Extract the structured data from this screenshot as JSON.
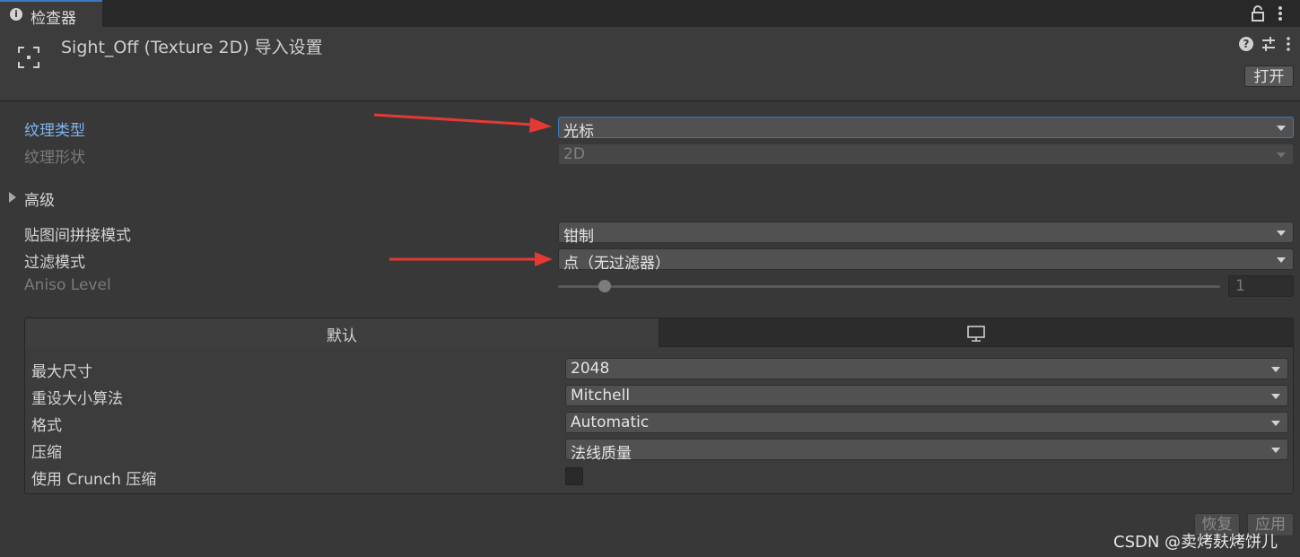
{
  "tab": {
    "label": "检查器"
  },
  "header": {
    "title": "Sight_Off (Texture 2D) 导入设置",
    "open_button": "打开"
  },
  "fields": {
    "texture_type": {
      "label": "纹理类型",
      "value": "光标"
    },
    "texture_shape": {
      "label": "纹理形状",
      "value": "2D"
    },
    "advanced": {
      "label": "高级"
    },
    "wrap_mode": {
      "label": "贴图间拼接模式",
      "value": "钳制"
    },
    "filter_mode": {
      "label": "过滤模式",
      "value": "点（无过滤器）"
    },
    "aniso_level": {
      "label": "Aniso Level",
      "value": "1",
      "slider_fraction": 0.07
    }
  },
  "platform": {
    "tab_default": "默认",
    "rows": {
      "max_size": {
        "label": "最大尺寸",
        "value": "2048"
      },
      "resize_algorithm": {
        "label": "重设大小算法",
        "value": "Mitchell"
      },
      "format": {
        "label": "格式",
        "value": "Automatic"
      },
      "compression": {
        "label": "压缩",
        "value": "法线质量"
      },
      "use_crunch": {
        "label": "使用 Crunch 压缩",
        "checked": false
      }
    }
  },
  "footer": {
    "revert": "恢复",
    "apply": "应用"
  },
  "watermark": "CSDN @卖烤麸烤饼儿",
  "colors": {
    "accent": "#3a79bb",
    "annotation_arrow": "#e53935"
  }
}
